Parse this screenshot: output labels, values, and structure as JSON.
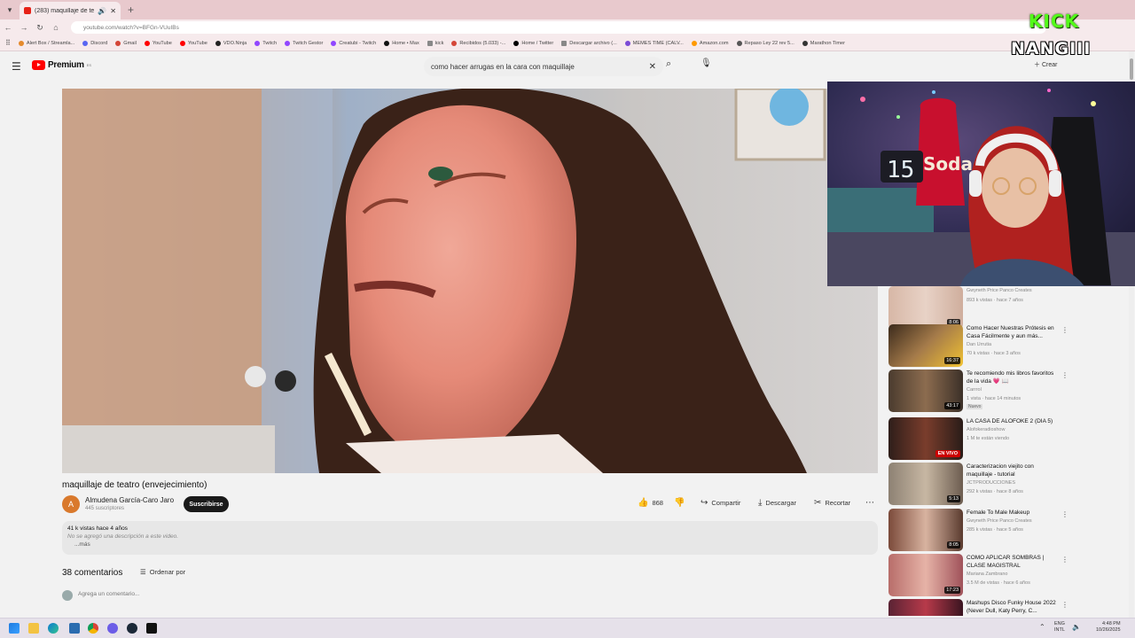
{
  "browser": {
    "tab_title": "(283) maquillaje de teatro (...",
    "url": "youtube.com/watch?v=BFGn-VUuIBs",
    "bookmarks": [
      "Alert Box / Streamla...",
      "Discord",
      "Gmail",
      "YouTube",
      "YouTube",
      "VDO.Ninja",
      "Twitch",
      "Twitch Gestor",
      "Creatubi - Twitch",
      "Home • Max",
      "kick",
      "Recibidos (5.033) -...",
      "Home / Twitter",
      "Descargar archivo (...",
      "MEMES TIME (CALV...",
      "Amazon.com",
      "Repaso Ley 22 rev 5...",
      "Marathon Timer"
    ]
  },
  "youtube": {
    "logo_text": "Premium",
    "logo_sup": "ES",
    "search_value": "como hacer arrugas en la cara con maquillaje",
    "create_label": "Crear"
  },
  "video": {
    "title": "maquillaje de teatro (envejecimiento)",
    "channel_initial": "A",
    "channel_name": "Almudena García-Caro Jaro",
    "subscribers": "445 suscriptores",
    "subscribe_label": "Suscribirse",
    "likes": "868",
    "share_label": "Compartir",
    "download_label": "Descargar",
    "clip_label": "Recortar",
    "views_date": "41 k vistas  hace 4 años",
    "description": "No se agregó una descripción a este video.",
    "more_label": "...más",
    "comments_count": "38 comentarios",
    "sort_label": "Ordenar por",
    "add_comment_placeholder": "Agrega un comentario..."
  },
  "recommendations": [
    {
      "title": "",
      "channel": "Gwyneth Price Panco Creates",
      "stats": "893 k vistas · hace 7 años",
      "duration": "8:06"
    },
    {
      "title": "Como Hacer Nuestras Prótesis en Casa Fácilmente y aun más...",
      "channel": "Dan Urrutia",
      "stats": "70 k vistas · hace 3 años",
      "duration": "16:37"
    },
    {
      "title": "Te recomiendo mis libros favoritos de la vida 💗 📖",
      "channel": "Carrrol",
      "stats": "1 vista · hace 14 minutos",
      "duration": "43:17",
      "badge": "Nuevo"
    },
    {
      "title": "LA CASA DE ALOFOKE 2 (DIA 5)",
      "channel": "Alofokeradioshow",
      "stats": "1 M te están viendo",
      "live": "EN VIVO"
    },
    {
      "title": "Caracterizacion viejito con maquillaje - tutorial",
      "channel": "JCTPRODUCCIONES",
      "stats": "292 k vistas · hace 8 años",
      "duration": "5:13"
    },
    {
      "title": "Female To Male Makeup",
      "channel": "Gwyneth Price Panco Creates",
      "stats": "285 k vistas · hace 5 años",
      "duration": "8:05"
    },
    {
      "title": "COMO APLICAR SOMBRAS | CLASE MAGISTRAL",
      "channel": "Mariana Zambrano",
      "stats": "3.5 M de vistas · hace 6 años",
      "duration": "17:23"
    },
    {
      "title": "Mashups Disco Funky House 2022 (Never Dull, Katy Perry, C...",
      "channel": "",
      "stats": "",
      "duration": ""
    }
  ],
  "overlay": {
    "platform": "KICK",
    "streamer": "NANGIII",
    "clock_digits": "15"
  },
  "taskbar": {
    "lang_top": "ENG",
    "lang_bottom": "INTL",
    "time": "4:48 PM",
    "date": "10/26/2025"
  },
  "colors": {
    "youtube_red": "#ff0000",
    "kick_green": "#53fc18",
    "tab_strip": "#e8c9cd"
  }
}
